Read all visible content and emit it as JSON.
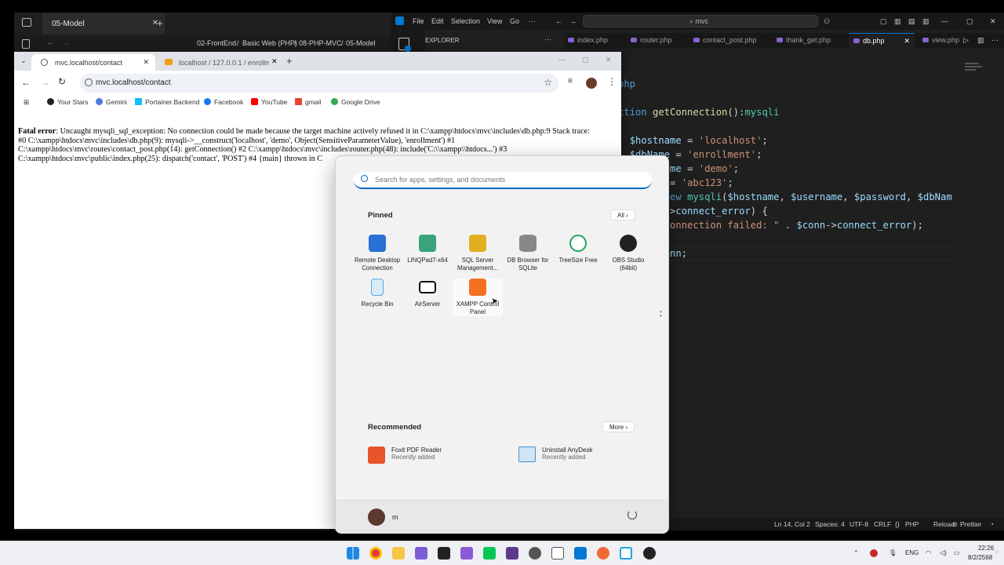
{
  "dark_app": {
    "tab_title": "05-Model",
    "breadcrumb": [
      "02-FrontEnd",
      "Basic Web (PHP)",
      "08-PHP-MVC",
      "05-Model"
    ]
  },
  "vscode": {
    "menu": [
      "File",
      "Edit",
      "Selection",
      "View",
      "Go",
      "···"
    ],
    "search_text": "mvc",
    "explorer_label": "EXPLORER",
    "tabs": [
      {
        "label": "index.php",
        "active": false
      },
      {
        "label": "router.php",
        "active": false
      },
      {
        "label": "contact_post.php",
        "active": false
      },
      {
        "label": "thank_get.php",
        "active": false
      },
      {
        "label": "db.php",
        "active": true
      },
      {
        "label": "view.php",
        "active": false
      }
    ],
    "code_lines": [
      "php",
      "",
      "ction getConnection():mysqli",
      "",
      "  $hostname = 'localhost';",
      "  $dbName = 'enrollment';",
      "  $username = 'demo';",
      "      rd = 'abc123';",
      "        new mysqli($hostname, $username, $password, $dbNam",
      "      nn->connect_error) {",
      "      (\"Connection failed: \" . $conn->connect_error);",
      "",
      "      $conn;"
    ],
    "status": {
      "position": "Ln 14, Col 2",
      "spaces": "Spaces: 4",
      "encoding": "UTF-8",
      "eol": "CRLF",
      "language": "PHP",
      "reload": "Reload",
      "prettier": "Prettier"
    }
  },
  "chrome": {
    "tabs": [
      {
        "label": "mvc.localhost/contact",
        "active": true
      },
      {
        "label": "localhost / 127.0.0.1 / enrollme",
        "active": false
      }
    ],
    "url": "mvc.localhost/contact",
    "bookmarks": [
      "Your Stars",
      "Gemini",
      "Portainer.Backend",
      "Facebook",
      "YouTube",
      "gmail",
      "Google Drive"
    ],
    "error_label": "Fatal error",
    "error_lines": [
      ": Uncaught mysqli_sql_exception: No connection could be made because the target machine actively refused it in C:\\xampp\\htdocs\\mvc\\includes\\db.php:9 Stack trace:",
      "#0 C:\\xampp\\htdocs\\mvc\\includes\\db.php(9): mysqli->__construct('localhost', 'demo', Object(SensitiveParameterValue), 'enrollment') #1",
      "C:\\xampp\\htdocs\\mvc\\routes\\contact_post.php(14): getConnection() #2 C:\\xampp\\htdocs\\mvc\\includes\\router.php(48): include('C:\\\\xampp\\\\htdocs...') #3",
      "C:\\xampp\\htdocs\\mvc\\public\\index.php(25): dispatch('contact', 'POST') #4 {main} thrown in C"
    ]
  },
  "start_menu": {
    "search_placeholder": "Search for apps, settings, and documents",
    "pinned_label": "Pinned",
    "all_button": "All",
    "pinned_apps": [
      {
        "name": "Remote Desktop Connection",
        "line1": "Remote Desktop",
        "line2": "Connection",
        "icon": "remote-desktop-icon",
        "color": "#2a6fd6"
      },
      {
        "name": "LINQPad7-x64",
        "line1": "LINQPad7-x64",
        "line2": "",
        "icon": "linqpad-icon",
        "color": "#3aa37a"
      },
      {
        "name": "SQL Server Management",
        "line1": "SQL Server",
        "line2": "Management...",
        "icon": "sql-server-icon",
        "color": "#e0b020"
      },
      {
        "name": "DB Browser for SQLite",
        "line1": "DB Browser for",
        "line2": "SQLite",
        "icon": "db-browser-icon",
        "color": "#888888"
      },
      {
        "name": "TreeSize Free",
        "line1": "TreeSize Free",
        "line2": "",
        "icon": "treesize-icon",
        "color": "#1fa45a"
      },
      {
        "name": "OBS Studio (64bit)",
        "line1": "OBS Studio",
        "line2": "(64bit)",
        "icon": "obs-icon",
        "color": "#222222"
      },
      {
        "name": "Recycle Bin",
        "line1": "Recycle Bin",
        "line2": "",
        "icon": "recycle-bin-icon",
        "color": "#5aa7e0"
      },
      {
        "name": "AirServer",
        "line1": "AirServer",
        "line2": "",
        "icon": "airserver-icon",
        "color": "#111111"
      },
      {
        "name": "XAMPP Control Panel",
        "line1": "XAMPP Control",
        "line2": "Panel",
        "icon": "xampp-icon",
        "color": "#f37021"
      }
    ],
    "recommended_label": "Recommended",
    "more_button": "More",
    "recommended": [
      {
        "name": "Foxit PDF Reader",
        "sub": "Recently added",
        "icon": "foxit-icon",
        "color": "#e8552a"
      },
      {
        "name": "Uninstall AnyDesk",
        "sub": "Recently added",
        "icon": "uninstall-icon",
        "color": "#4a90c8"
      }
    ],
    "user_name": "m"
  },
  "taskbar": {
    "language": "ENG",
    "time": "22:26",
    "date": "8/2/2568"
  }
}
